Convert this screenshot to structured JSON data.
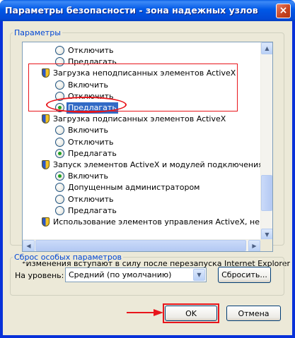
{
  "window": {
    "title": "Параметры безопасности - зона надежных узлов",
    "close_glyph": "×"
  },
  "settings": {
    "group_label": "Параметры",
    "items": [
      {
        "type": "radio",
        "label": "Отключить",
        "checked": false
      },
      {
        "type": "radio",
        "label": "Предлагать",
        "checked": false
      },
      {
        "type": "category",
        "label": "Загрузка неподписанных элементов ActiveX",
        "icon": "shield-icon"
      },
      {
        "type": "radio",
        "label": "Включить",
        "checked": false
      },
      {
        "type": "radio",
        "label": "Отключить",
        "checked": false
      },
      {
        "type": "radio",
        "label": "Предлагать",
        "checked": true,
        "selected": true
      },
      {
        "type": "category",
        "label": "Загрузка подписанных элементов ActiveX",
        "icon": "shield-icon"
      },
      {
        "type": "radio",
        "label": "Включить",
        "checked": false
      },
      {
        "type": "radio",
        "label": "Отключить",
        "checked": false
      },
      {
        "type": "radio",
        "label": "Предлагать",
        "checked": true
      },
      {
        "type": "category",
        "label": "Запуск элементов ActiveX и модулей подключения",
        "icon": "shield-icon"
      },
      {
        "type": "radio",
        "label": "Включить",
        "checked": true
      },
      {
        "type": "radio",
        "label": "Допущенным администратором",
        "checked": false
      },
      {
        "type": "radio",
        "label": "Отключить",
        "checked": false
      },
      {
        "type": "radio",
        "label": "Предлагать",
        "checked": false
      },
      {
        "type": "category",
        "label": "Использование элементов управления ActiveX, не помеч",
        "icon": "shield-icon"
      }
    ],
    "note": "*Изменения вступают в силу после перезапуска Internet Explorer"
  },
  "reset": {
    "group_label": "Сброс особых параметров",
    "level_label": "На уровень:",
    "level_value": "Средний (по умолчанию)",
    "reset_button": "Сбросить..."
  },
  "buttons": {
    "ok": "OK",
    "cancel": "Отмена"
  },
  "colors": {
    "highlight": "#e8151b",
    "selection": "#316ac5"
  }
}
